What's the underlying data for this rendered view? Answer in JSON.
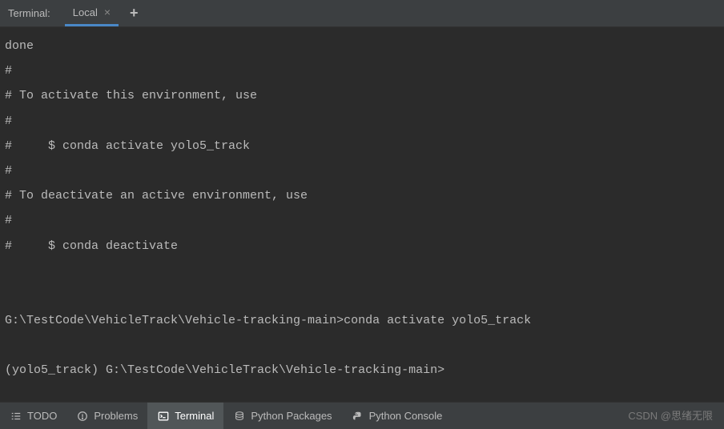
{
  "header": {
    "title": "Terminal:",
    "tab_label": "Local",
    "tab_close": "×",
    "add_tab": "+"
  },
  "terminal": {
    "lines": [
      "done",
      "#",
      "# To activate this environment, use",
      "#",
      "#     $ conda activate yolo5_track",
      "#",
      "# To deactivate an active environment, use",
      "#",
      "#     $ conda deactivate",
      "",
      "",
      "G:\\TestCode\\VehicleTrack\\Vehicle-tracking-main>conda activate yolo5_track",
      "",
      "(yolo5_track) G:\\TestCode\\VehicleTrack\\Vehicle-tracking-main>"
    ]
  },
  "bottom": {
    "todo": "TODO",
    "problems": "Problems",
    "terminal": "Terminal",
    "python_packages": "Python Packages",
    "python_console": "Python Console"
  },
  "watermark": "CSDN @思绪无限"
}
